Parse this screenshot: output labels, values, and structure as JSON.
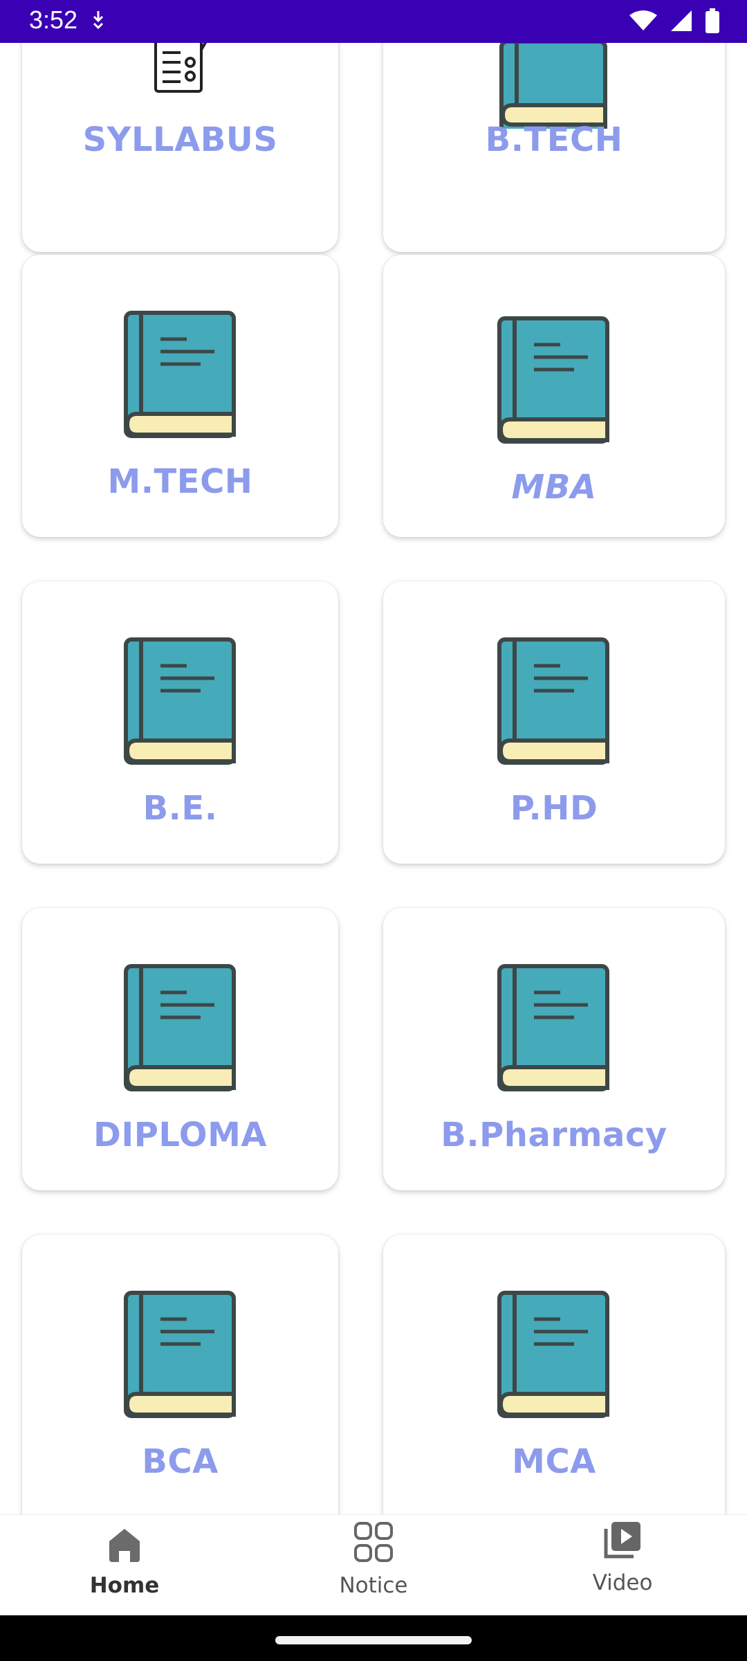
{
  "status_bar": {
    "time": "3:52"
  },
  "grid": [
    {
      "label": "SYLLABUS",
      "icon": "syllabus-icon"
    },
    {
      "label": "B.TECH",
      "icon": "book-icon"
    },
    {
      "label": "M.TECH",
      "icon": "book-icon"
    },
    {
      "label": "MBA",
      "icon": "book-icon"
    },
    {
      "label": "B.E.",
      "icon": "book-icon"
    },
    {
      "label": "P.HD",
      "icon": "book-icon"
    },
    {
      "label": "DIPLOMA",
      "icon": "book-icon"
    },
    {
      "label": "B.Pharmacy",
      "icon": "book-icon"
    },
    {
      "label": "BCA",
      "icon": "book-icon"
    },
    {
      "label": "MCA",
      "icon": "book-icon"
    }
  ],
  "bottom_nav": [
    {
      "label": "Home",
      "icon": "home-icon",
      "active": true
    },
    {
      "label": "Notice",
      "icon": "grid-icon",
      "active": false
    },
    {
      "label": "Video",
      "icon": "video-library-icon",
      "active": false
    }
  ],
  "colors": {
    "status_bar": "#3a00b3",
    "card_label": "#8c9bec",
    "book_cover": "#45aab9",
    "book_pages": "#f8edb5",
    "outline": "#3d4747"
  }
}
